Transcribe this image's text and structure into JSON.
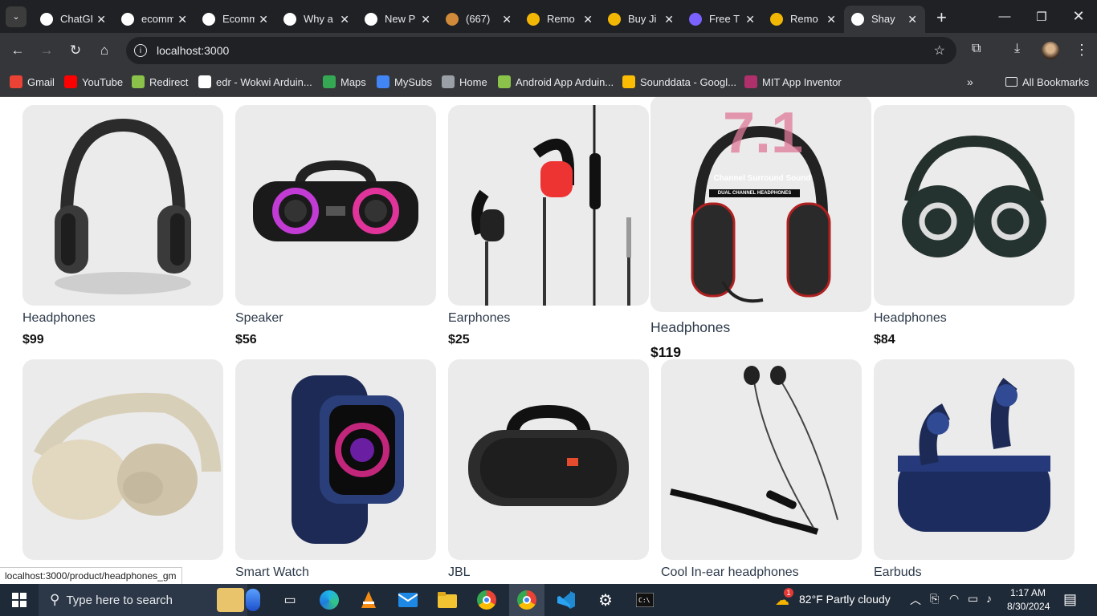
{
  "browser": {
    "tabs": [
      {
        "label": "ChatGPT",
        "icon": "chatgpt-icon",
        "color": "#ffffff"
      },
      {
        "label": "ecommerce",
        "icon": "github-icon",
        "color": "#ffffff"
      },
      {
        "label": "Ecommerce",
        "icon": "github-icon",
        "color": "#ffffff"
      },
      {
        "label": "Why a",
        "icon": "vercel-icon",
        "color": "#ffffff"
      },
      {
        "label": "New P",
        "icon": "vercel-icon",
        "color": "#ffffff"
      },
      {
        "label": "(667)",
        "icon": "torch-icon",
        "color": "#d08a3a"
      },
      {
        "label": "Remo",
        "icon": "remove-bg-icon",
        "color": "#f2b705"
      },
      {
        "label": "Buy Ji",
        "icon": "buy-icon",
        "color": "#f2b705"
      },
      {
        "label": "Free T",
        "icon": "triangle-icon",
        "color": "#7b61ff"
      },
      {
        "label": "Remo",
        "icon": "remove-bg-icon",
        "color": "#f2b705"
      },
      {
        "label": "Shay",
        "icon": "vercel-icon",
        "color": "#ffffff"
      }
    ],
    "url": "localhost:3000",
    "bookmarks": [
      {
        "label": "Gmail",
        "icon": "gmail-icon",
        "color": "#ea4335"
      },
      {
        "label": "YouTube",
        "icon": "youtube-icon",
        "color": "#ff0000"
      },
      {
        "label": "Redirect",
        "icon": "redirect-icon",
        "color": "#8bc34a"
      },
      {
        "label": "edr - Wokwi Arduin...",
        "icon": "wokwi-icon",
        "color": "#ffffff"
      },
      {
        "label": "Maps",
        "icon": "maps-icon",
        "color": "#34a853"
      },
      {
        "label": "MySubs",
        "icon": "mysubs-icon",
        "color": "#4285f4"
      },
      {
        "label": "Home",
        "icon": "globe-icon",
        "color": "#9aa0a6"
      },
      {
        "label": "Android App Arduin...",
        "icon": "android-app-icon",
        "color": "#8bc34a"
      },
      {
        "label": "Sounddata - Googl...",
        "icon": "drive-icon",
        "color": "#fbbc04"
      },
      {
        "label": "MIT App Inventor",
        "icon": "mit-icon",
        "color": "#b0306c"
      }
    ],
    "all_bookmarks": "All Bookmarks",
    "status_url": "localhost:3000/product/headphones_gm"
  },
  "products": [
    {
      "name": "Headphones",
      "price": "$99",
      "kind": "headphones-black"
    },
    {
      "name": "Speaker",
      "price": "$56",
      "kind": "speaker"
    },
    {
      "name": "Earphones",
      "price": "$25",
      "kind": "earphones"
    },
    {
      "name": "Headphones",
      "price": "$119",
      "kind": "gaming-headphones",
      "badge_big": "7.1",
      "badge_small": "Channel Surround Sound",
      "badge_label": "DUAL CHANNEL HEADPHONES"
    },
    {
      "name": "Headphones",
      "price": "$84",
      "kind": "dj-headphones"
    },
    {
      "name": "",
      "price": "",
      "kind": "headphones-beige"
    },
    {
      "name": "Smart Watch",
      "price": "",
      "kind": "watch"
    },
    {
      "name": "JBL",
      "price": "",
      "kind": "jbl"
    },
    {
      "name": "Cool In-ear headphones",
      "price": "",
      "kind": "neckband"
    },
    {
      "name": "Earbuds",
      "price": "",
      "kind": "earbuds"
    }
  ],
  "taskbar": {
    "search_placeholder": "Type here to search",
    "weather": "82°F  Partly cloudy",
    "weather_badge": "1",
    "time": "1:17 AM",
    "date": "8/30/2024"
  }
}
